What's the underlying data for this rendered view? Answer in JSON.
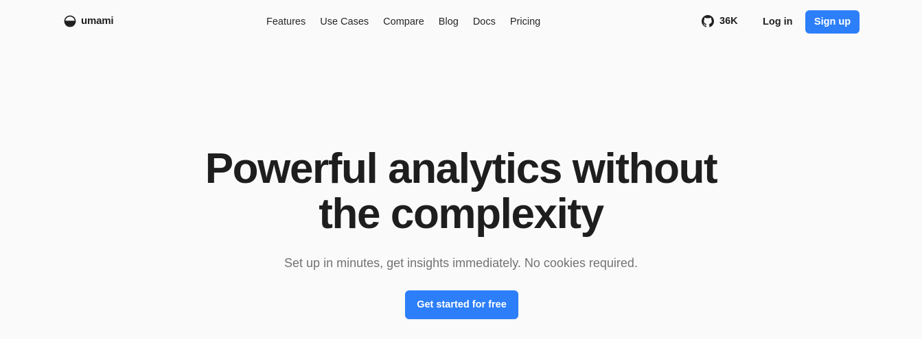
{
  "brand": {
    "name": "umami",
    "logo_icon": "umami-bowl-logo"
  },
  "nav": {
    "items": [
      {
        "label": "Features"
      },
      {
        "label": "Use Cases"
      },
      {
        "label": "Compare"
      },
      {
        "label": "Blog"
      },
      {
        "label": "Docs"
      },
      {
        "label": "Pricing"
      }
    ]
  },
  "header_actions": {
    "github_icon": "github-icon",
    "github_stars": "36K",
    "login_label": "Log in",
    "signup_label": "Sign up"
  },
  "hero": {
    "title_line1": "Powerful analytics without",
    "title_line2": "the complexity",
    "subtitle": "Set up in minutes, get insights immediately. No cookies required.",
    "cta_label": "Get started for free"
  },
  "colors": {
    "background": "#fafafa",
    "accent": "#2d7ff9",
    "text": "#1f1f1f",
    "muted": "#737373"
  }
}
